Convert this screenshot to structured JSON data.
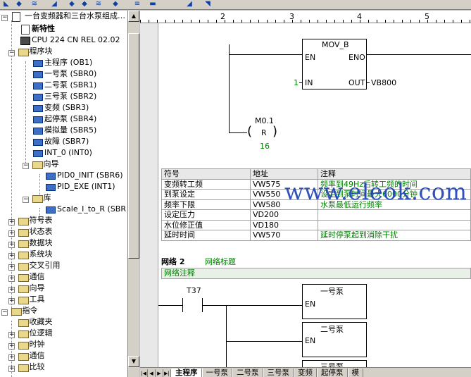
{
  "tree": {
    "root": "一台变频器和三台水泵组成…",
    "items": [
      {
        "label": "新特性",
        "bold": true
      },
      {
        "label": "CPU 224 CN REL 02.02"
      },
      {
        "label": "程序块"
      },
      {
        "label": "主程序 (OB1)"
      },
      {
        "label": "一号泵 (SBR0)"
      },
      {
        "label": "二号泵 (SBR1)"
      },
      {
        "label": "三号泵 (SBR2)"
      },
      {
        "label": "变频 (SBR3)"
      },
      {
        "label": "起停泵 (SBR4)"
      },
      {
        "label": "模拟量 (SBR5)"
      },
      {
        "label": "故障 (SBR7)"
      },
      {
        "label": "INT_0 (INT0)"
      },
      {
        "label": "向导"
      },
      {
        "label": "PID0_INIT (SBR6)"
      },
      {
        "label": "PID_EXE (INT1)"
      },
      {
        "label": "库"
      },
      {
        "label": "Scale_I_to_R (SBR"
      },
      {
        "label": "符号表"
      },
      {
        "label": "状态表"
      },
      {
        "label": "数据块"
      },
      {
        "label": "系统块"
      },
      {
        "label": "交叉引用"
      },
      {
        "label": "通信"
      },
      {
        "label": "向导"
      },
      {
        "label": "工具"
      },
      {
        "label": "指令"
      },
      {
        "label": "收藏夹"
      },
      {
        "label": "位逻辑"
      },
      {
        "label": "时钟"
      },
      {
        "label": "通信"
      },
      {
        "label": "比较"
      }
    ]
  },
  "ruler": {
    "marks": [
      "2",
      "3",
      "4",
      "5"
    ]
  },
  "ladder": {
    "mov_title": "MOV_B",
    "en": "EN",
    "eno": "ENO",
    "in": "IN",
    "out": "OUT",
    "in_value": "1",
    "out_value": "VB800",
    "coil_addr": "M0.1",
    "coil_type": "R",
    "coil_count": "16"
  },
  "symtable": {
    "headers": [
      "符号",
      "地址",
      "注释"
    ],
    "rows": [
      [
        "变频转工频",
        "VW575",
        "频率到49Hz后转工频的时间"
      ],
      [
        "到泵设定",
        "VW550",
        "设定到泵时间最大6000分钟"
      ],
      [
        "频率下限",
        "VW580",
        "水泵最低运行频率"
      ],
      [
        "设定压力",
        "VD200",
        ""
      ],
      [
        "水位修正值",
        "VD180",
        ""
      ],
      [
        "延时时间",
        "VW570",
        "延时停泵起到消除干扰"
      ]
    ]
  },
  "network2": {
    "label": "网络 2",
    "title": "网络标题",
    "comment": "网络注释",
    "contact": "T37",
    "box1": "一号泵",
    "box2": "二号泵",
    "box3": "三号泵",
    "en": "EN"
  },
  "watermark": "www.eleok.com",
  "tabs": [
    "主程序",
    "一号泵",
    "二号泵",
    "三号泵",
    "变频",
    "起停泵",
    "模"
  ]
}
